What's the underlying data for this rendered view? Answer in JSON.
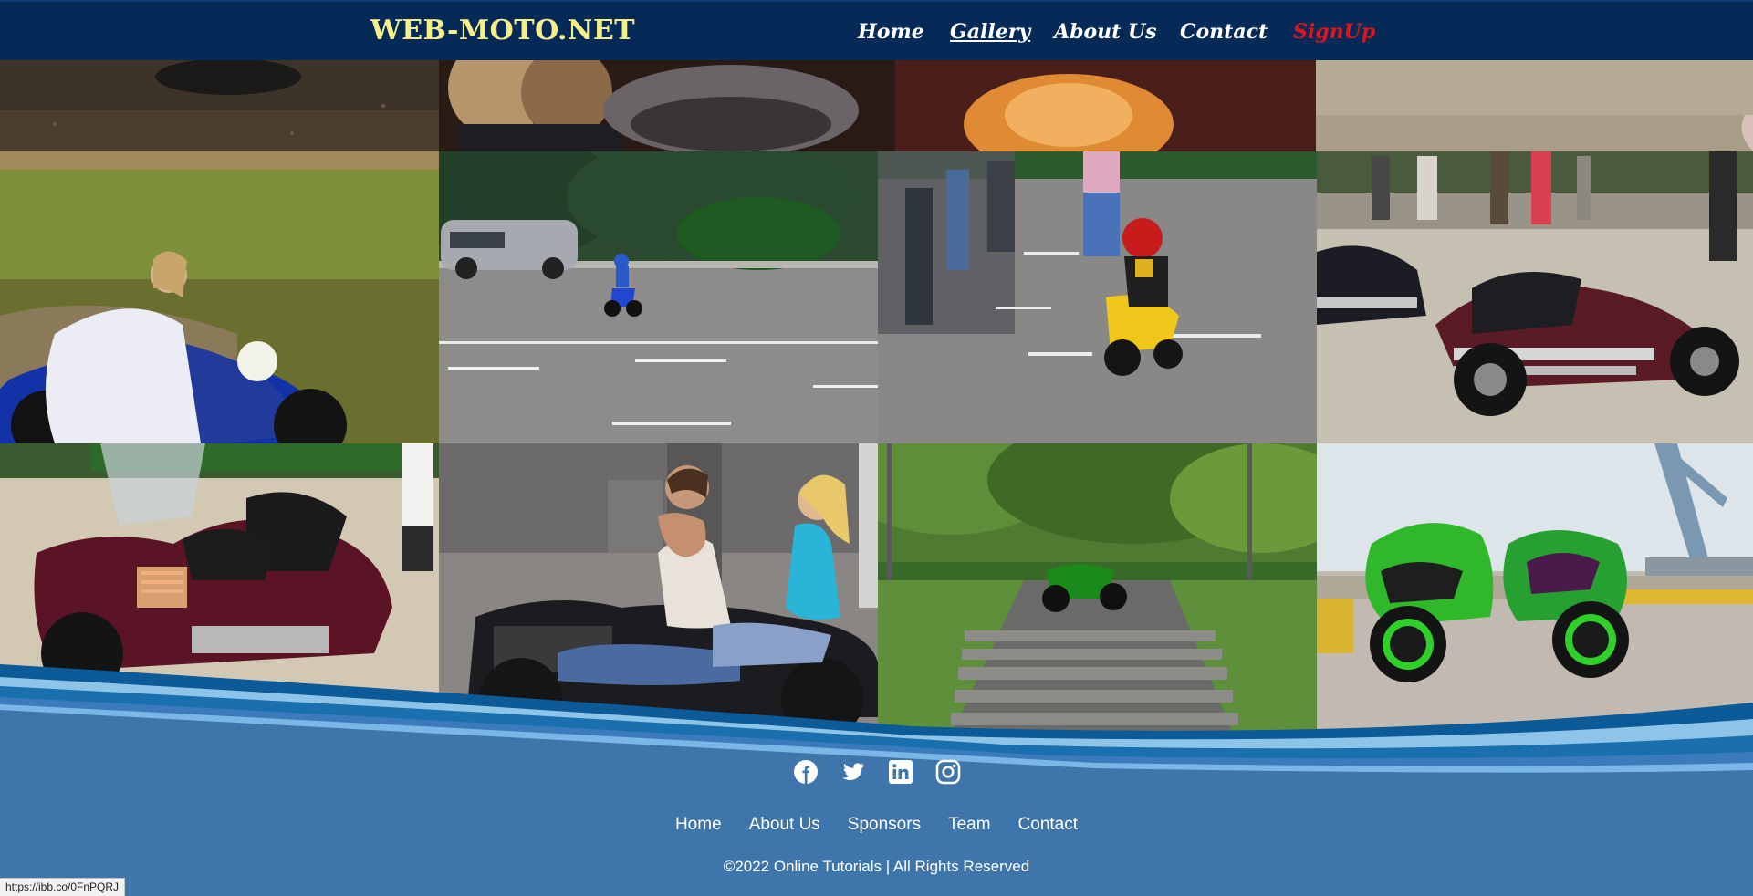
{
  "header": {
    "logo": "WEB-MOTO.NET",
    "nav": [
      {
        "label": "Home",
        "active": false
      },
      {
        "label": "Gallery",
        "active": true
      },
      {
        "label": "About Us",
        "active": false
      },
      {
        "label": "Contact",
        "active": false
      },
      {
        "label": "SignUp",
        "active": false
      }
    ]
  },
  "gallery": {
    "images": [
      "ground-shadow-photo",
      "crowd-heads-photo",
      "stone-wall-photo",
      "bride-on-motorcycle-photo",
      "child-on-blue-dirt-bike-photo",
      "child-on-yellow-pocket-bike-photo",
      "cruiser-motorcycles-parked-photo",
      "touring-motorcycle-photo",
      "couple-riding-motorcycle-photo",
      "green-motorcycle-on-park-steps-photo",
      "two-green-sportbikes-at-harbor-photo"
    ]
  },
  "footer": {
    "social": [
      "facebook-icon",
      "twitter-icon",
      "linkedin-icon",
      "instagram-icon"
    ],
    "links": [
      "Home",
      "About Us",
      "Sponsors",
      "Team",
      "Contact"
    ],
    "copyright": "©2022 Online Tutorials | All Rights Reserved"
  },
  "status_url": "https://ibb.co/0FnPQRJ",
  "colors": {
    "header_bg": "#062a58",
    "logo": "#f5f08a",
    "signup": "#e0141e",
    "footer_bg": "#3e76ab",
    "wave_dark": "#0c5a98",
    "wave_light": "#8ec4e8"
  }
}
